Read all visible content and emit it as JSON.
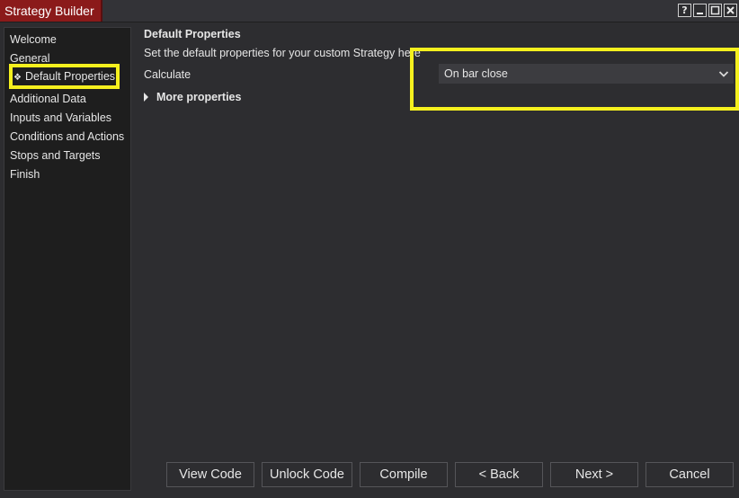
{
  "window": {
    "title": "Strategy Builder",
    "controls": {
      "help": "?",
      "minimize": "—",
      "maximize": "□",
      "close": "✕"
    }
  },
  "sidebar": {
    "items": [
      {
        "label": "Welcome"
      },
      {
        "label": "General"
      },
      {
        "label": "Default Properties",
        "active": true,
        "bullet": "❖"
      },
      {
        "label": "Additional Data"
      },
      {
        "label": "Inputs and Variables"
      },
      {
        "label": "Conditions and Actions"
      },
      {
        "label": "Stops and Targets"
      },
      {
        "label": "Finish"
      }
    ]
  },
  "main": {
    "title": "Default Properties",
    "description": "Set the default properties for your custom Strategy here",
    "calculate_label": "Calculate",
    "calculate_value": "On bar close",
    "more_properties_label": "More properties"
  },
  "footer": {
    "view_code": "View Code",
    "unlock_code": "Unlock Code",
    "compile": "Compile",
    "back": "< Back",
    "next": "Next >",
    "cancel": "Cancel"
  },
  "colors": {
    "highlight": "#f5f01e",
    "title_tab": "#8b1a1a",
    "background": "#2d2d30"
  }
}
